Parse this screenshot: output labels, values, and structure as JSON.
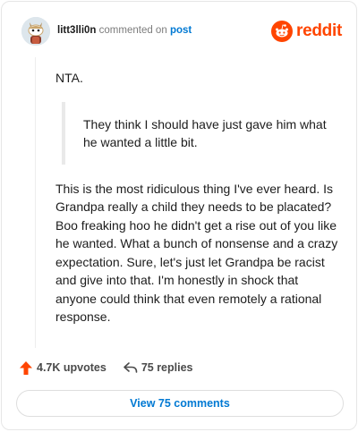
{
  "header": {
    "username": "litt3lli0n",
    "action_text": "commented on",
    "post_link": "post",
    "brand": "reddit"
  },
  "comment": {
    "first_line": "NTA.",
    "quote": "They think I should have just gave him what he wanted a little bit.",
    "body": "This is the most ridiculous thing I've ever heard. Is Grandpa really a child they needs to be placated? Boo freaking hoo he didn't get a rise out of you like he wanted. What a bunch of nonsense and a crazy expectation. Sure, let's just let Grandpa be racist and give into that. I'm honestly in shock that anyone could think that even remotely a rational response."
  },
  "actions": {
    "upvotes": "4.7K upvotes",
    "replies": "75 replies"
  },
  "view_button": "View 75 comments",
  "colors": {
    "brand": "#ff4500",
    "link": "#0079d3",
    "upvote": "#ff4500"
  },
  "icons": {
    "avatar": "snoo-avatar",
    "brand": "reddit-logo-icon",
    "upvote": "upvote-arrow-icon",
    "reply": "reply-arrow-icon"
  }
}
